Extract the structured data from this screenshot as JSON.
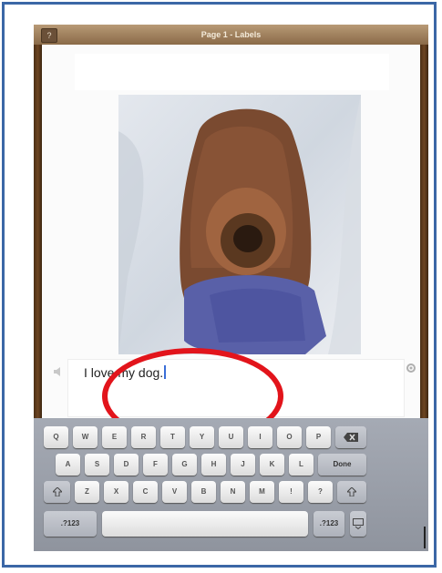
{
  "titlebar": {
    "help_label": "?",
    "title": "Page 1 - Labels"
  },
  "caption": {
    "text": "I love my dog."
  },
  "keyboard": {
    "row1": [
      "Q",
      "W",
      "E",
      "R",
      "T",
      "Y",
      "U",
      "I",
      "O",
      "P"
    ],
    "row2": [
      "A",
      "S",
      "D",
      "F",
      "G",
      "H",
      "J",
      "K",
      "L"
    ],
    "row3": [
      "Z",
      "X",
      "C",
      "V",
      "B",
      "N",
      "M"
    ],
    "row3_punct": [
      "!",
      "?"
    ],
    "done_label": "Done",
    "numbers_label": ".?123",
    "backspace_icon": "backspace-icon",
    "shift_icon": "shift-icon",
    "hide_keyboard_icon": "keyboard-hide-icon"
  },
  "colors": {
    "frame_border": "#3b67a6",
    "annotation_oval": "#e2141b",
    "titlebar": "#9a7a56"
  }
}
